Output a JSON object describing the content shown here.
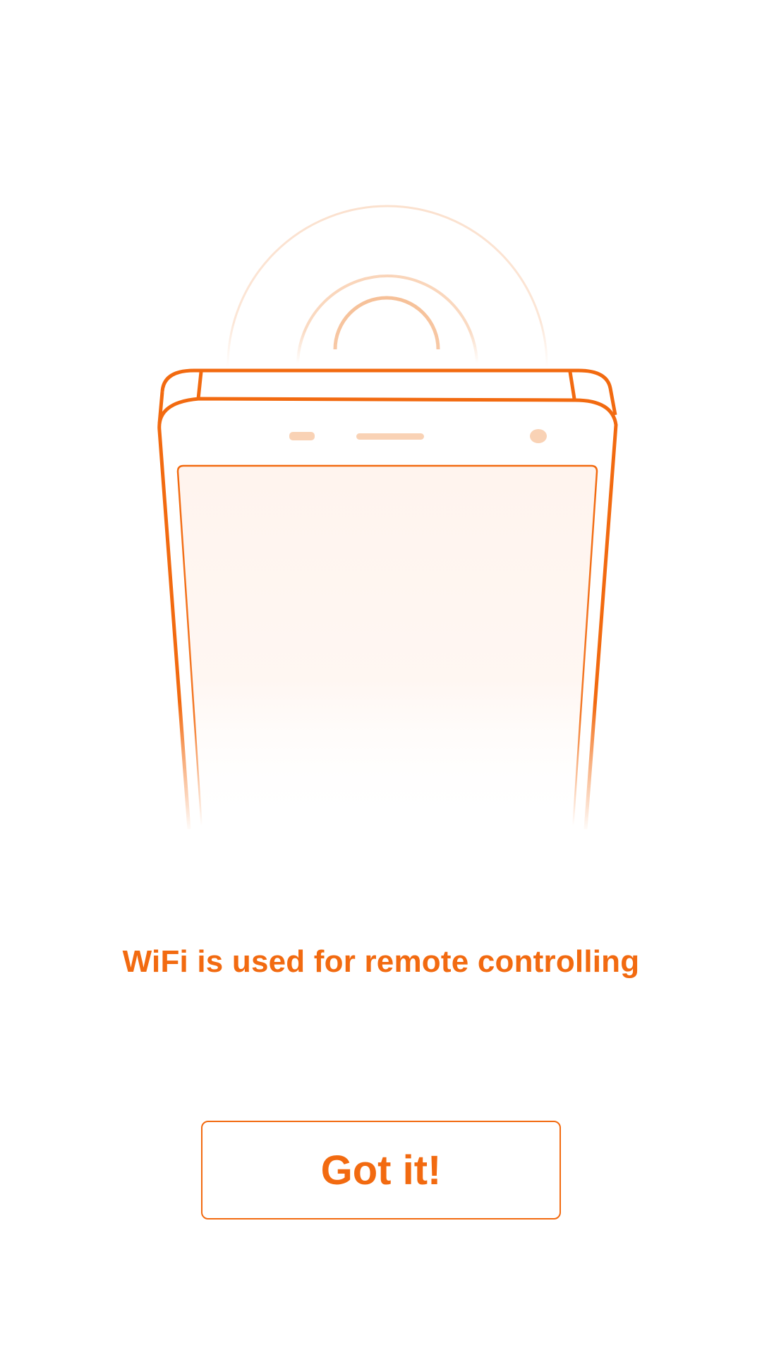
{
  "illustration": {
    "icon": "phone-wifi-signal-icon",
    "accent_color": "#f26a10",
    "screen_fill_color": "#fff4ee",
    "signal_color": "#f8c7a5"
  },
  "message": {
    "text": "WiFi is used for remote controlling"
  },
  "actions": {
    "got_it_label": "Got it!"
  }
}
